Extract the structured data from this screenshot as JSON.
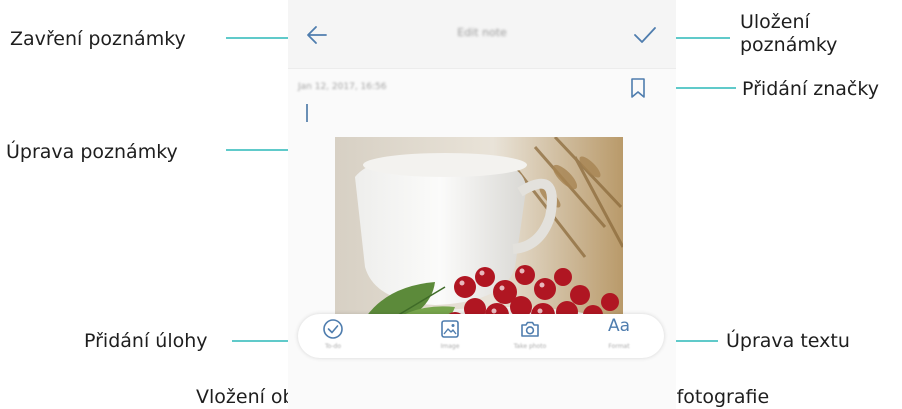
{
  "callouts": {
    "close_note": "Zavření poznámky",
    "save_note_line1": "Uložení",
    "save_note_line2": "poznámky",
    "add_tag": "Přidání značky",
    "edit_note": "Úprava poznámky",
    "add_task": "Přidání úlohy",
    "edit_text": "Úprava textu",
    "insert_image": "Vložení obrázku",
    "take_photo": "Nasnímání fotografie"
  },
  "screen": {
    "title": "Edit note",
    "date": "Jan 12, 2017, 16:56",
    "toolbar": [
      {
        "label": "To-do",
        "icon": "checklist-icon"
      },
      {
        "label": "Image",
        "icon": "image-icon"
      },
      {
        "label": "Take photo",
        "icon": "camera-icon"
      },
      {
        "label": "Format",
        "icon": "text-format-icon",
        "glyph": "Aa"
      }
    ]
  },
  "colors": {
    "accent_icon": "#4f7dae",
    "callout_line": "#2bb8b8",
    "callout_text": "#1e1e1e"
  }
}
